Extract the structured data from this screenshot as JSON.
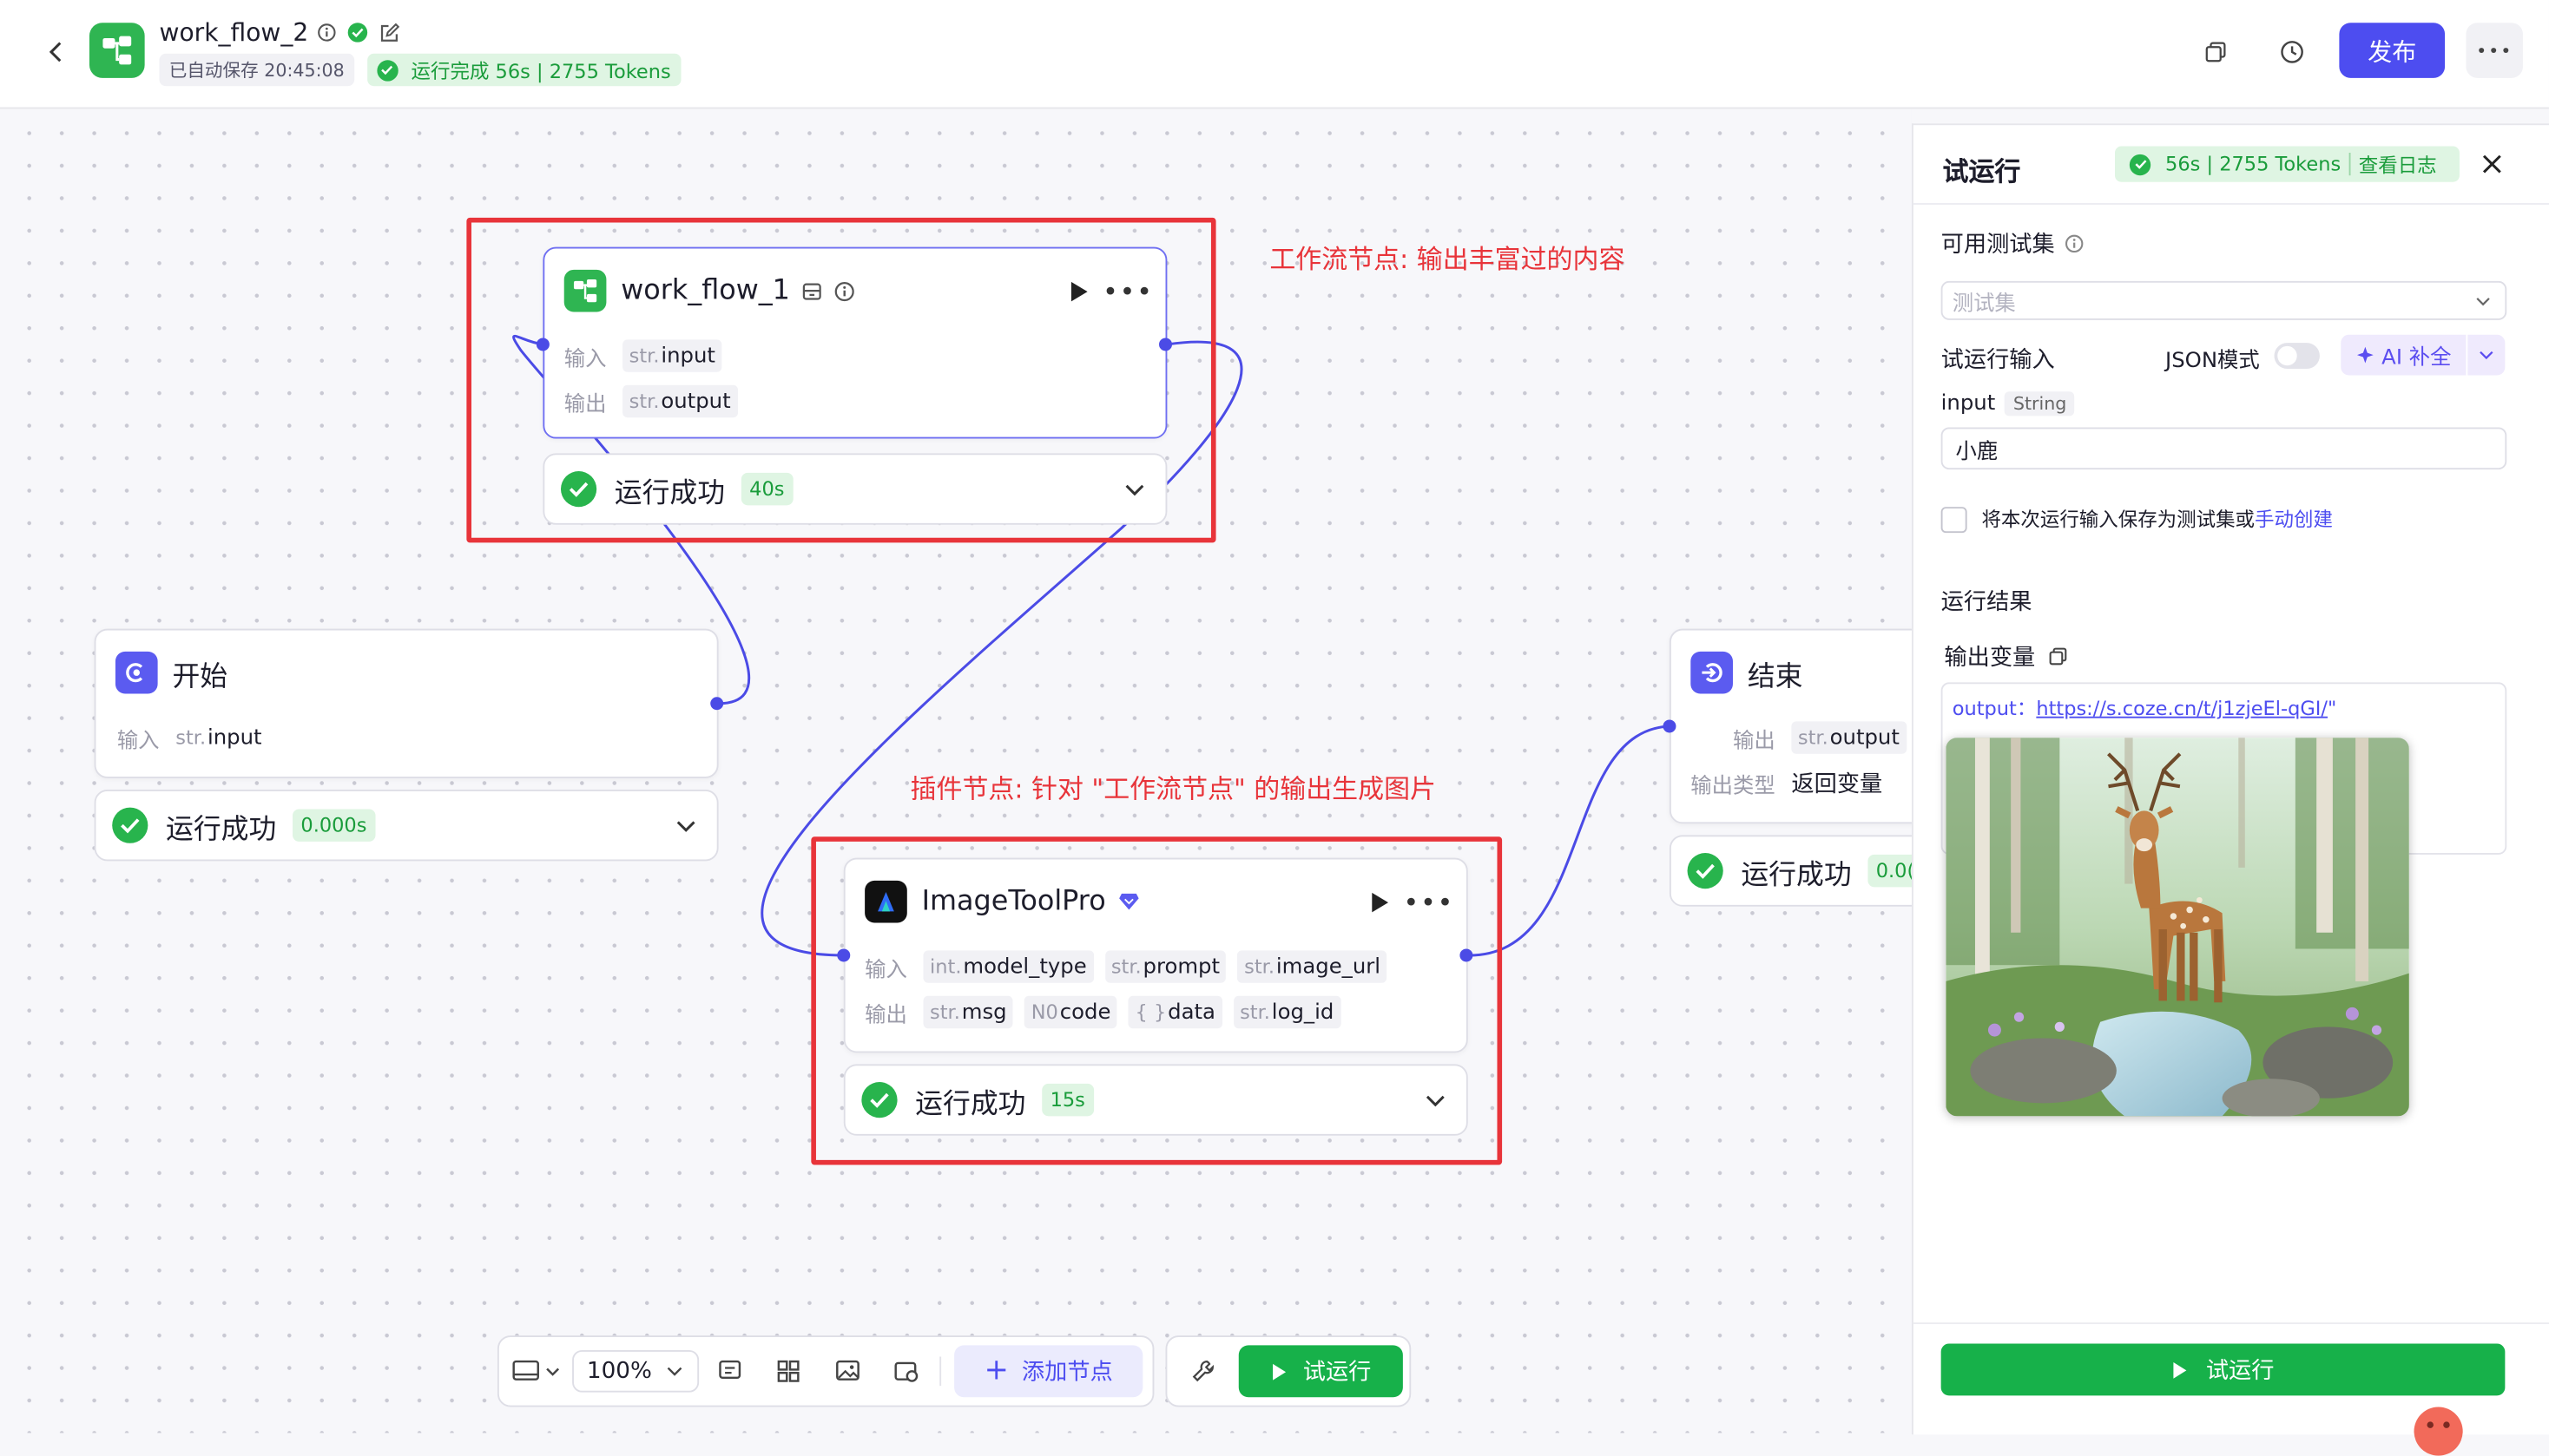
{
  "header": {
    "title": "work_flow_2",
    "autosave": "已自动保存 20:45:08",
    "run_status": "运行完成 56s | 2755 Tokens",
    "publish": "发布"
  },
  "nodes": {
    "workflow1": {
      "title": "work_flow_1",
      "in_label": "输入",
      "out_label": "输出",
      "inputs": [
        {
          "type": "str.",
          "name": "input"
        }
      ],
      "outputs": [
        {
          "type": "str.",
          "name": "output"
        }
      ],
      "status": "运行成功",
      "time": "40s"
    },
    "start": {
      "title": "开始",
      "in_label": "输入",
      "inputs": [
        {
          "type": "str.",
          "name": "input"
        }
      ],
      "status": "运行成功",
      "time": "0.000s"
    },
    "imagetool": {
      "title": "ImageToolPro",
      "in_label": "输入",
      "out_label": "输出",
      "inputs": [
        {
          "type": "int.",
          "name": "model_type"
        },
        {
          "type": "str.",
          "name": "prompt"
        },
        {
          "type": "str.",
          "name": "image_url"
        }
      ],
      "outputs": [
        {
          "type": "str.",
          "name": "msg"
        },
        {
          "type": "N0",
          "name": "code"
        },
        {
          "type": "{ }",
          "name": "data"
        },
        {
          "type": "str.",
          "name": "log_id"
        }
      ],
      "status": "运行成功",
      "time": "15s"
    },
    "end": {
      "title": "结束",
      "out_label": "输出",
      "out_type_label": "输出类型",
      "outputs": [
        {
          "type": "str.",
          "name": "output"
        }
      ],
      "out_type_value": "返回变量",
      "status": "运行成功",
      "time": "0.0("
    }
  },
  "annotations": {
    "workflow": "工作流节点: 输出丰富过的内容",
    "plugin": "插件节点: 针对 \"工作流节点\" 的输出生成图片"
  },
  "toolbar": {
    "zoom": "100%",
    "add_node": "添加节点",
    "test_run": "试运行"
  },
  "panel": {
    "title": "试运行",
    "tokens": "56s | 2755 Tokens",
    "view_log": "查看日志",
    "available_sets": "可用测试集",
    "set_placeholder": "测试集",
    "test_input": "试运行输入",
    "json_mode": "JSON模式",
    "ai_fill": "AI 补全",
    "input_name": "input",
    "input_type": "String",
    "input_value": "小鹿",
    "save_text": "将本次运行输入保存为测试集或",
    "manual_create": "手动创建",
    "results": "运行结果",
    "output_var": "输出变量",
    "output_key": "output：",
    "output_url": "https://s.coze.cn/t/j1zjeEl-qGI/",
    "output_suffix": "\"",
    "run_button": "试运行"
  }
}
